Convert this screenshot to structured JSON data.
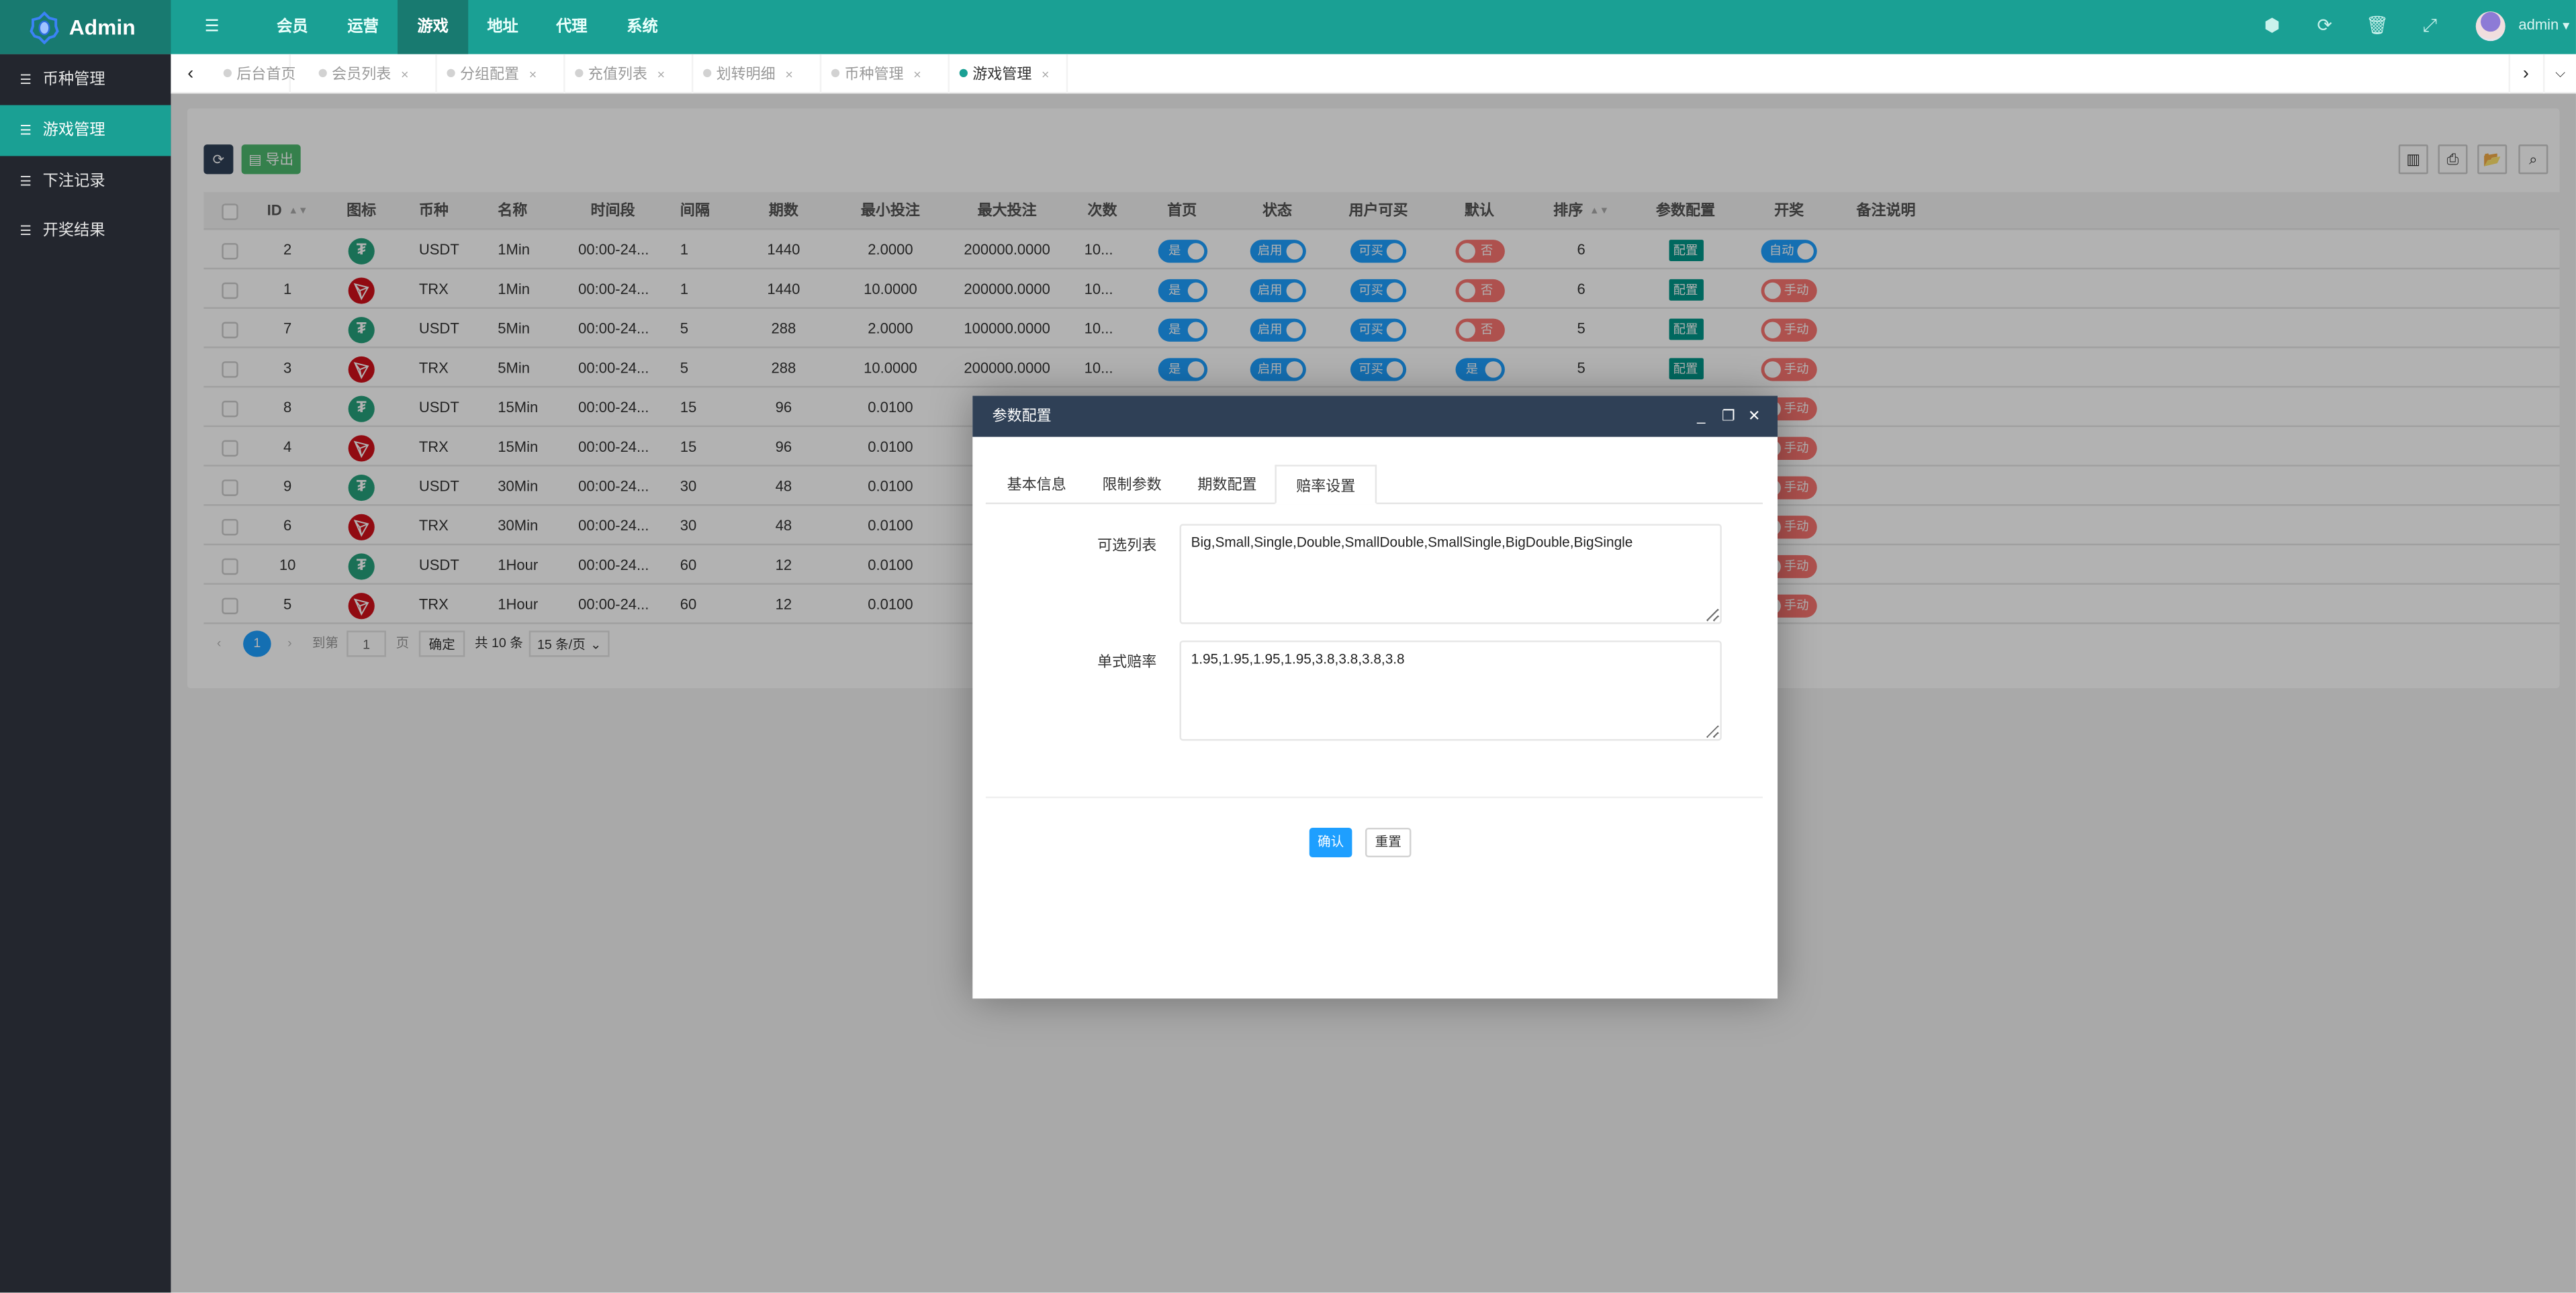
{
  "app": {
    "logo_text": "Admin"
  },
  "topnav": {
    "menu_toggle_icon": "list-indent-icon",
    "items": [
      {
        "label": "会员"
      },
      {
        "label": "运营"
      },
      {
        "label": "游戏",
        "active": true
      },
      {
        "label": "地址"
      },
      {
        "label": "代理"
      },
      {
        "label": "系统"
      }
    ],
    "right_icons": [
      "theme-icon",
      "refresh-icon",
      "trash-icon",
      "fullscreen-icon"
    ],
    "user": "admin"
  },
  "sidebar": {
    "items": [
      {
        "label": "币种管理"
      },
      {
        "label": "游戏管理",
        "active": true
      },
      {
        "label": "下注记录"
      },
      {
        "label": "开奖结果"
      }
    ]
  },
  "tabs": [
    {
      "label": "后台首页",
      "closable": false
    },
    {
      "label": "会员列表",
      "closable": true
    },
    {
      "label": "分组配置",
      "closable": true
    },
    {
      "label": "充值列表",
      "closable": true
    },
    {
      "label": "划转明细",
      "closable": true
    },
    {
      "label": "币种管理",
      "closable": true
    },
    {
      "label": "游戏管理",
      "closable": true,
      "active": true
    }
  ],
  "toolbar": {
    "export_label": "导出",
    "close_x": "×"
  },
  "table": {
    "columns": [
      "ID",
      "图标",
      "币种",
      "名称",
      "时间段",
      "间隔",
      "期数",
      "最小投注",
      "最大投注",
      "次数",
      "首页",
      "状态",
      "用户可买",
      "默认",
      "排序",
      "参数配置",
      "开奖",
      "备注说明"
    ],
    "rows": [
      {
        "id": "2",
        "coin": "USDT",
        "name": "1Min",
        "period": "00:00-24...",
        "interval": "1",
        "issues": "1440",
        "min_bet": "2.0000",
        "max_bet": "200000.0000",
        "times": "10...",
        "home": "是",
        "status": "启用",
        "buy": "可买",
        "default": "否",
        "sort": "6",
        "config": "配置",
        "draw": "自动"
      },
      {
        "id": "1",
        "coin": "TRX",
        "name": "1Min",
        "period": "00:00-24...",
        "interval": "1",
        "issues": "1440",
        "min_bet": "10.0000",
        "max_bet": "200000.0000",
        "times": "10...",
        "home": "是",
        "status": "启用",
        "buy": "可买",
        "default": "否",
        "sort": "6",
        "config": "配置",
        "draw": "手动"
      },
      {
        "id": "7",
        "coin": "USDT",
        "name": "5Min",
        "period": "00:00-24...",
        "interval": "5",
        "issues": "288",
        "min_bet": "2.0000",
        "max_bet": "100000.0000",
        "times": "10...",
        "home": "是",
        "status": "启用",
        "buy": "可买",
        "default": "否",
        "sort": "5",
        "config": "配置",
        "draw": "手动"
      },
      {
        "id": "3",
        "coin": "TRX",
        "name": "5Min",
        "period": "00:00-24...",
        "interval": "5",
        "issues": "288",
        "min_bet": "10.0000",
        "max_bet": "200000.0000",
        "times": "10...",
        "home": "是",
        "status": "启用",
        "buy": "可买",
        "default": "是",
        "sort": "5",
        "config": "配置",
        "draw": "手动"
      },
      {
        "id": "8",
        "coin": "USDT",
        "name": "15Min",
        "period": "00:00-24...",
        "interval": "15",
        "issues": "96",
        "min_bet": "0.0100",
        "draw": "手动"
      },
      {
        "id": "4",
        "coin": "TRX",
        "name": "15Min",
        "period": "00:00-24...",
        "interval": "15",
        "issues": "96",
        "min_bet": "0.0100",
        "draw": "手动"
      },
      {
        "id": "9",
        "coin": "USDT",
        "name": "30Min",
        "period": "00:00-24...",
        "interval": "30",
        "issues": "48",
        "min_bet": "0.0100",
        "draw": "手动"
      },
      {
        "id": "6",
        "coin": "TRX",
        "name": "30Min",
        "period": "00:00-24...",
        "interval": "30",
        "issues": "48",
        "min_bet": "0.0100",
        "draw": "手动"
      },
      {
        "id": "10",
        "coin": "USDT",
        "name": "1Hour",
        "period": "00:00-24...",
        "interval": "60",
        "issues": "12",
        "min_bet": "0.0100",
        "draw": "手动"
      },
      {
        "id": "5",
        "coin": "TRX",
        "name": "1Hour",
        "period": "00:00-24...",
        "interval": "60",
        "issues": "12",
        "min_bet": "0.0100",
        "draw": "手动"
      }
    ]
  },
  "pagination": {
    "current": "1",
    "goto_label": "到第",
    "page_input": "1",
    "page_suffix": "页",
    "confirm": "确定",
    "total": "共 10 条",
    "page_size": "15 条/页"
  },
  "modal": {
    "title": "参数配置",
    "tabs": [
      {
        "label": "基本信息"
      },
      {
        "label": "限制参数"
      },
      {
        "label": "期数配置"
      },
      {
        "label": "赔率设置",
        "active": true
      }
    ],
    "fields": {
      "options_label": "可选列表",
      "options_value": "Big,Small,Single,Double,SmallDouble,SmallSingle,BigDouble,BigSingle",
      "odds_label": "单式赔率",
      "odds_value": "1.95,1.95,1.95,1.95,3.8,3.8,3.8,3.8"
    },
    "confirm": "确认",
    "reset": "重置"
  },
  "colors": {
    "header": "#1aa094",
    "sidebar": "#23262e",
    "switch_on": "#1e9fff",
    "switch_off": "#fa7570",
    "config_btn": "#009688",
    "modal_header": "#2f4056",
    "usdt": "#26a17b",
    "trx": "#d0101b"
  }
}
